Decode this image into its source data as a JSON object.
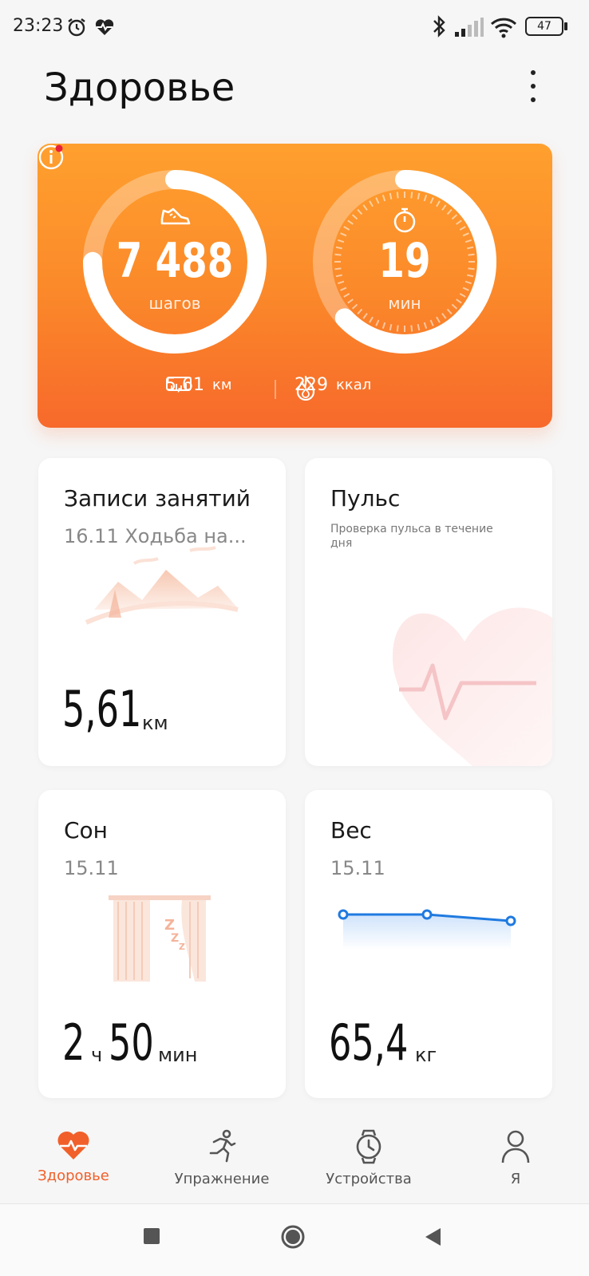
{
  "status_bar": {
    "time": "23:23",
    "icons": [
      "alarm-icon",
      "heart-pulse-icon",
      "bluetooth-icon",
      "signal-icon",
      "wifi-icon",
      "battery-icon"
    ],
    "battery_level": "47"
  },
  "header": {
    "title": "Здоровье",
    "menu_icon": "more-vertical-icon"
  },
  "activity": {
    "steps": {
      "value": "7 488",
      "unit": "шагов",
      "icon": "sneaker-icon",
      "progress": 0.75
    },
    "active_time": {
      "value": "19",
      "unit": "мин",
      "icon": "stopwatch-icon",
      "progress": 0.63
    },
    "distance": {
      "value": "5,61",
      "unit": "км",
      "icon": "ruler-icon"
    },
    "calories": {
      "value": "229",
      "unit": "ккал",
      "icon": "flame-icon"
    },
    "info_icon": "info-icon",
    "accent": "#f7692b"
  },
  "cards": {
    "workouts": {
      "title": "Записи занятий",
      "subtitle": "16.11 Ходьба на...",
      "value": "5,61",
      "unit": "км"
    },
    "pulse": {
      "title": "Пульс",
      "subtitle": "Проверка пульса в течение дня"
    },
    "sleep": {
      "title": "Сон",
      "date": "15.11",
      "hours": "2",
      "hours_unit": "ч",
      "minutes": "50",
      "minutes_unit": "мин"
    },
    "weight": {
      "title": "Вес",
      "date": "15.11",
      "value": "65,4",
      "unit": "кг",
      "trend": [
        65.5,
        65.5,
        65.4
      ]
    }
  },
  "nav": {
    "items": [
      {
        "label": "Здоровье",
        "icon": "heart-icon",
        "active": true
      },
      {
        "label": "Упражнение",
        "icon": "running-icon",
        "active": false
      },
      {
        "label": "Устройства",
        "icon": "watch-icon",
        "active": false
      },
      {
        "label": "Я",
        "icon": "person-icon",
        "active": false
      }
    ],
    "active_color": "#f1602a"
  },
  "system_nav": {
    "buttons": [
      "square-icon",
      "home-circle-icon",
      "back-triangle-icon"
    ]
  }
}
